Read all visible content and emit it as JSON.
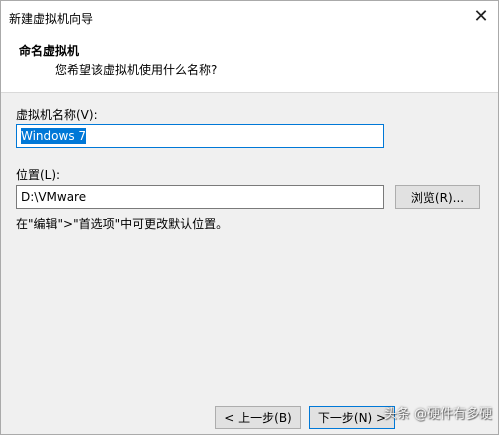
{
  "window": {
    "title": "新建虚拟机向导",
    "close_glyph": "✕"
  },
  "header": {
    "title": "命名虚拟机",
    "subtitle": "您希望该虚拟机使用什么名称?"
  },
  "vm_name": {
    "label": "虚拟机名称(V):",
    "value": "Windows 7"
  },
  "location": {
    "label": "位置(L):",
    "value": "D:\\VMware",
    "browse_label": "浏览(R)..."
  },
  "hint": "在\"编辑\">\"首选项\"中可更改默认位置。",
  "footer": {
    "back_label": "< 上一步(B)",
    "next_label": "下一步(N) >"
  },
  "watermark": "头条 @硬件有多硬"
}
